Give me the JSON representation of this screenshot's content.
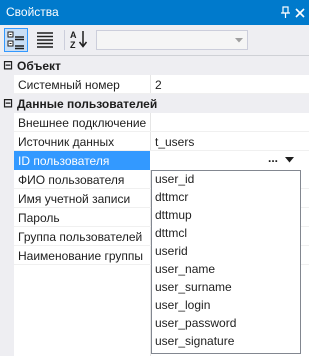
{
  "window": {
    "title": "Свойства",
    "pin_glyph": "⬆",
    "close_glyph": "✕"
  },
  "toolbar": {
    "categorized_icon": "categorized-icon",
    "alphabetical_icon": "alphabetical-icon",
    "sort_az_icon": "sort-az-icon",
    "object_selector_value": ""
  },
  "grid": {
    "categories": [
      {
        "toggle": "⊟",
        "label": "Объект"
      },
      {
        "toggle": "⊟",
        "label": "Данные пользователей"
      }
    ],
    "props": [
      {
        "name": "Системный номер",
        "value": "2"
      },
      {
        "name": "Внешнее подключение",
        "value": ""
      },
      {
        "name": "Источник данных",
        "value": "t_users"
      },
      {
        "name": "ID пользователя",
        "value": "",
        "ellipsis": "..."
      },
      {
        "name": "ФИО пользователя",
        "value": ""
      },
      {
        "name": "Имя учетной записи",
        "value": ""
      },
      {
        "name": "Пароль",
        "value": ""
      },
      {
        "name": "Группа пользователей",
        "value": ""
      },
      {
        "name": "Наименование группы",
        "value": ""
      }
    ]
  },
  "dropdown": {
    "options": [
      "user_id",
      "dttmcr",
      "dttmup",
      "dttmcl",
      "userid",
      "user_name",
      "user_surname",
      "user_login",
      "user_password",
      "user_signature"
    ]
  },
  "colors": {
    "accent": "#007acc",
    "selection": "#3399ff",
    "toolbar_bg": "#eeeef2"
  }
}
